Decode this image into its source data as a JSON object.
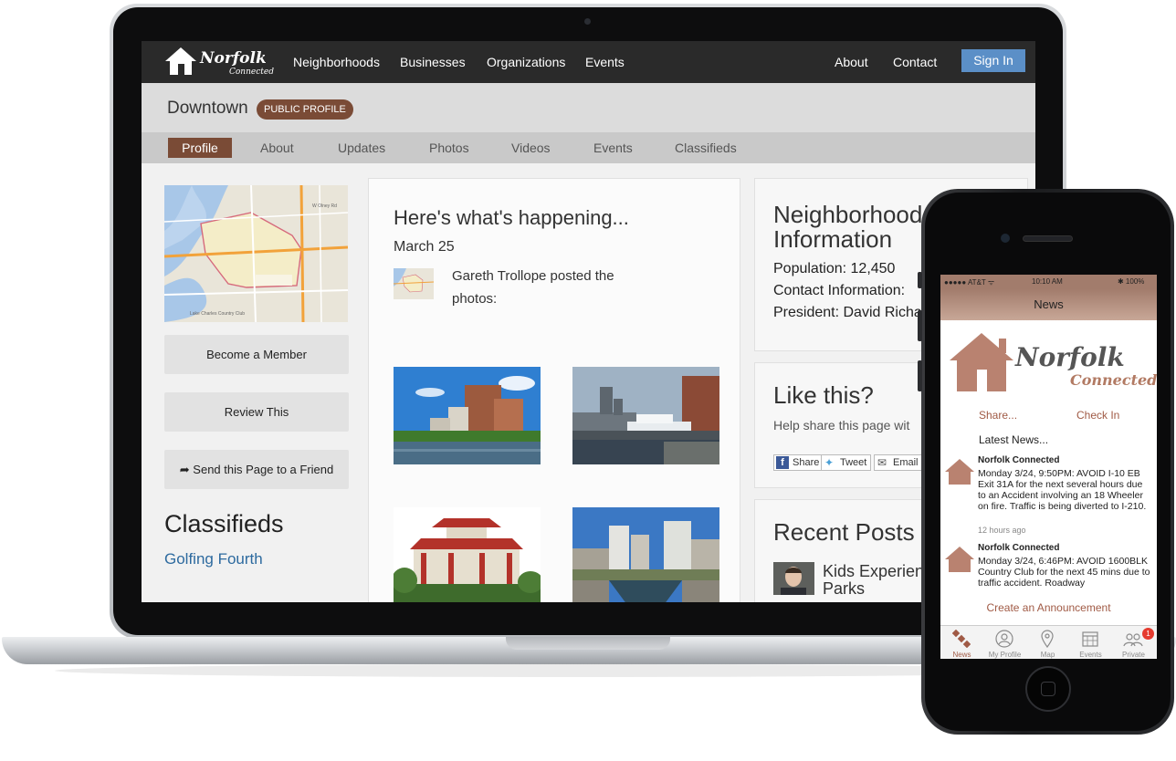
{
  "site": {
    "logo_word": "Norfolk",
    "logo_sub": "Connected",
    "nav_left": [
      "Neighborhoods",
      "Businesses",
      "Organizations",
      "Events"
    ],
    "nav_right": [
      "About",
      "Contact"
    ],
    "signin_label": "Sign In"
  },
  "profile": {
    "title": "Downtown",
    "badge": "PUBLIC PROFILE",
    "tabs": [
      "Profile",
      "About",
      "Updates",
      "Photos",
      "Videos",
      "Events",
      "Classifieds"
    ],
    "active_tab": "Profile"
  },
  "sidebar": {
    "map_labels": [
      "W Olney Rd",
      "Lake Charles Country Club"
    ],
    "buttons": [
      "Become a Member",
      "Review This",
      "Send this Page to a Friend"
    ],
    "classifieds_heading": "Classifieds",
    "classifieds_item": "Golfing Fourth"
  },
  "feed": {
    "title": "Here's what's happening...",
    "date": "March 25",
    "post_text": "Gareth Trollope posted the photos:"
  },
  "neighborhood": {
    "heading_line1": "Neighborhood",
    "heading_line2": "Information",
    "population_label": "Population:",
    "population_value": "12,450",
    "contact_label": "Contact Information:",
    "president_label": "President:",
    "president_value": "David Richa"
  },
  "like": {
    "heading": "Like this?",
    "subtext": "Help share this page wit",
    "buttons": [
      "Share",
      "Tweet",
      "Email"
    ]
  },
  "recent": {
    "heading": "Recent Posts",
    "post_title_line1": "Kids Experience",
    "post_title_line2": "Parks"
  },
  "phone": {
    "carrier": "●●●●● AT&T ᯤ",
    "time": "10:10 AM",
    "battery": "✱ 100%",
    "header_title": "News",
    "logo_word": "Norfolk",
    "logo_sub": "Connected",
    "share_label": "Share...",
    "checkin_label": "Check In",
    "latest_label": "Latest News...",
    "news": [
      {
        "source": "Norfolk Connected",
        "body": "Monday 3/24, 9:50PM: AVOID I-10 EB Exit 31A for the next several hours due to an Accident involving an 18 Wheeler on fire. Traffic is being diverted to I-210.",
        "time": "12 hours ago"
      },
      {
        "source": "Norfolk Connected",
        "body": "Monday 3/24, 6:46PM: AVOID 1600BLK Country Club for the next 45 mins due to traffic accident. Roadway",
        "time": ""
      }
    ],
    "create_label": "Create an Announcement",
    "tabs": [
      "News",
      "My Profile",
      "Map",
      "Events",
      "Private"
    ],
    "private_badge": "1"
  },
  "colors": {
    "brand_brown": "#7a4b36",
    "signin_blue": "#5b8fc7",
    "link_blue": "#2d6a9f",
    "phone_accent": "#a05a45"
  }
}
